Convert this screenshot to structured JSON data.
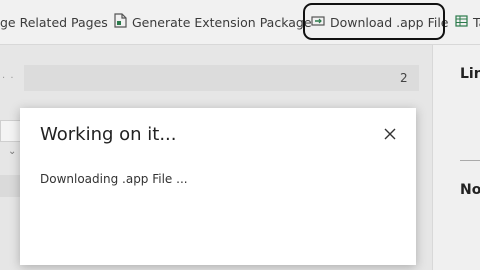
{
  "toolbar": {
    "items": [
      {
        "label": "ge Related Pages",
        "icon": "related-pages-icon"
      },
      {
        "label": "Generate Extension Package",
        "icon": "document-icon"
      },
      {
        "label": "Download .app File",
        "icon": "download-icon"
      },
      {
        "label": "Ta",
        "icon": "table-icon"
      }
    ]
  },
  "content": {
    "row_value": "2"
  },
  "side_panel": {
    "label_top": "Lin",
    "label_bottom": "No"
  },
  "dialog": {
    "title": "Working on it...",
    "message": "Downloading .app File ...",
    "close_icon": "close-icon"
  },
  "colors": {
    "highlight_border": "#111111",
    "icon_accent": "#2b7a4b"
  }
}
